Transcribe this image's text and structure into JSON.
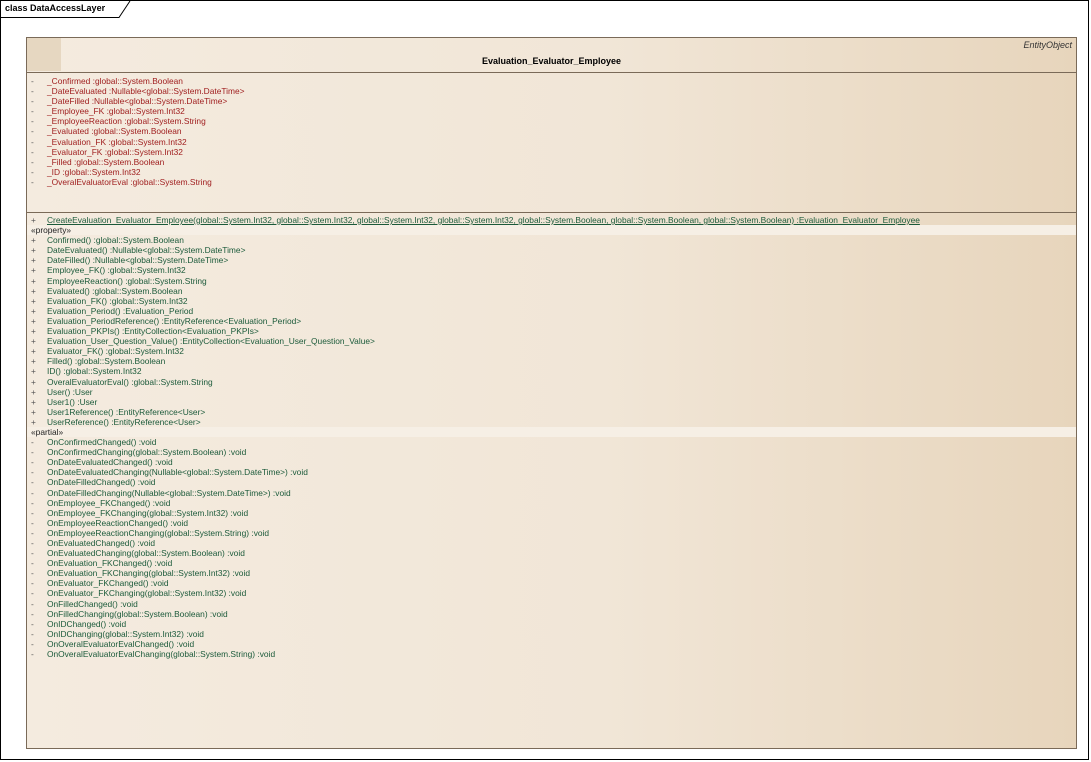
{
  "frame": {
    "label": "class DataAccessLayer"
  },
  "class_box": {
    "stereotype": "EntityObject",
    "name": "Evaluation_Evaluator_Employee",
    "attributes": [
      {
        "vis": "-",
        "text": "_Confirmed  :global::System.Boolean"
      },
      {
        "vis": "-",
        "text": "_DateEvaluated  :Nullable<global::System.DateTime>"
      },
      {
        "vis": "-",
        "text": "_DateFilled  :Nullable<global::System.DateTime>"
      },
      {
        "vis": "-",
        "text": "_Employee_FK  :global::System.Int32"
      },
      {
        "vis": "-",
        "text": "_EmployeeReaction  :global::System.String"
      },
      {
        "vis": "-",
        "text": "_Evaluated  :global::System.Boolean"
      },
      {
        "vis": "-",
        "text": "_Evaluation_FK  :global::System.Int32"
      },
      {
        "vis": "-",
        "text": "_Evaluator_FK  :global::System.Int32"
      },
      {
        "vis": "-",
        "text": "_Filled  :global::System.Boolean"
      },
      {
        "vis": "-",
        "text": "_ID  :global::System.Int32"
      },
      {
        "vis": "-",
        "text": "_OveralEvaluatorEval  :global::System.String"
      }
    ],
    "static_op": {
      "vis": "+",
      "text": "CreateEvaluation_Evaluator_Employee(global::System.Int32, global::System.Int32, global::System.Int32, global::System.Int32, global::System.Boolean, global::System.Boolean, global::System.Boolean)  :Evaluation_Evaluator_Employee"
    },
    "property_label": "«property»",
    "properties": [
      {
        "vis": "+",
        "text": "Confirmed()  :global::System.Boolean"
      },
      {
        "vis": "+",
        "text": "DateEvaluated()  :Nullable<global::System.DateTime>"
      },
      {
        "vis": "+",
        "text": "DateFilled()  :Nullable<global::System.DateTime>"
      },
      {
        "vis": "+",
        "text": "Employee_FK()  :global::System.Int32"
      },
      {
        "vis": "+",
        "text": "EmployeeReaction()  :global::System.String"
      },
      {
        "vis": "+",
        "text": "Evaluated()  :global::System.Boolean"
      },
      {
        "vis": "+",
        "text": "Evaluation_FK()  :global::System.Int32"
      },
      {
        "vis": "+",
        "text": "Evaluation_Period()  :Evaluation_Period"
      },
      {
        "vis": "+",
        "text": "Evaluation_PeriodReference()  :EntityReference<Evaluation_Period>"
      },
      {
        "vis": "+",
        "text": "Evaluation_PKPIs()  :EntityCollection<Evaluation_PKPIs>"
      },
      {
        "vis": "+",
        "text": "Evaluation_User_Question_Value()  :EntityCollection<Evaluation_User_Question_Value>"
      },
      {
        "vis": "+",
        "text": "Evaluator_FK()  :global::System.Int32"
      },
      {
        "vis": "+",
        "text": "Filled()  :global::System.Boolean"
      },
      {
        "vis": "+",
        "text": "ID()  :global::System.Int32"
      },
      {
        "vis": "+",
        "text": "OveralEvaluatorEval()  :global::System.String"
      },
      {
        "vis": "+",
        "text": "User()  :User"
      },
      {
        "vis": "+",
        "text": "User1()  :User"
      },
      {
        "vis": "+",
        "text": "User1Reference()  :EntityReference<User>"
      },
      {
        "vis": "+",
        "text": "UserReference()  :EntityReference<User>"
      }
    ],
    "partial_label": "«partial»",
    "partials": [
      {
        "vis": "-",
        "text": "OnConfirmedChanged()  :void"
      },
      {
        "vis": "-",
        "text": "OnConfirmedChanging(global::System.Boolean)  :void"
      },
      {
        "vis": "-",
        "text": "OnDateEvaluatedChanged()  :void"
      },
      {
        "vis": "-",
        "text": "OnDateEvaluatedChanging(Nullable<global::System.DateTime>)  :void"
      },
      {
        "vis": "-",
        "text": "OnDateFilledChanged()  :void"
      },
      {
        "vis": "-",
        "text": "OnDateFilledChanging(Nullable<global::System.DateTime>)  :void"
      },
      {
        "vis": "-",
        "text": "OnEmployee_FKChanged()  :void"
      },
      {
        "vis": "-",
        "text": "OnEmployee_FKChanging(global::System.Int32)  :void"
      },
      {
        "vis": "-",
        "text": "OnEmployeeReactionChanged()  :void"
      },
      {
        "vis": "-",
        "text": "OnEmployeeReactionChanging(global::System.String)  :void"
      },
      {
        "vis": "-",
        "text": "OnEvaluatedChanged()  :void"
      },
      {
        "vis": "-",
        "text": "OnEvaluatedChanging(global::System.Boolean)  :void"
      },
      {
        "vis": "-",
        "text": "OnEvaluation_FKChanged()  :void"
      },
      {
        "vis": "-",
        "text": "OnEvaluation_FKChanging(global::System.Int32)  :void"
      },
      {
        "vis": "-",
        "text": "OnEvaluator_FKChanged()  :void"
      },
      {
        "vis": "-",
        "text": "OnEvaluator_FKChanging(global::System.Int32)  :void"
      },
      {
        "vis": "-",
        "text": "OnFilledChanged()  :void"
      },
      {
        "vis": "-",
        "text": "OnFilledChanging(global::System.Boolean)  :void"
      },
      {
        "vis": "-",
        "text": "OnIDChanged()  :void"
      },
      {
        "vis": "-",
        "text": "OnIDChanging(global::System.Int32)  :void"
      },
      {
        "vis": "-",
        "text": "OnOveralEvaluatorEvalChanged()  :void"
      },
      {
        "vis": "-",
        "text": "OnOveralEvaluatorEvalChanging(global::System.String)  :void"
      }
    ]
  }
}
